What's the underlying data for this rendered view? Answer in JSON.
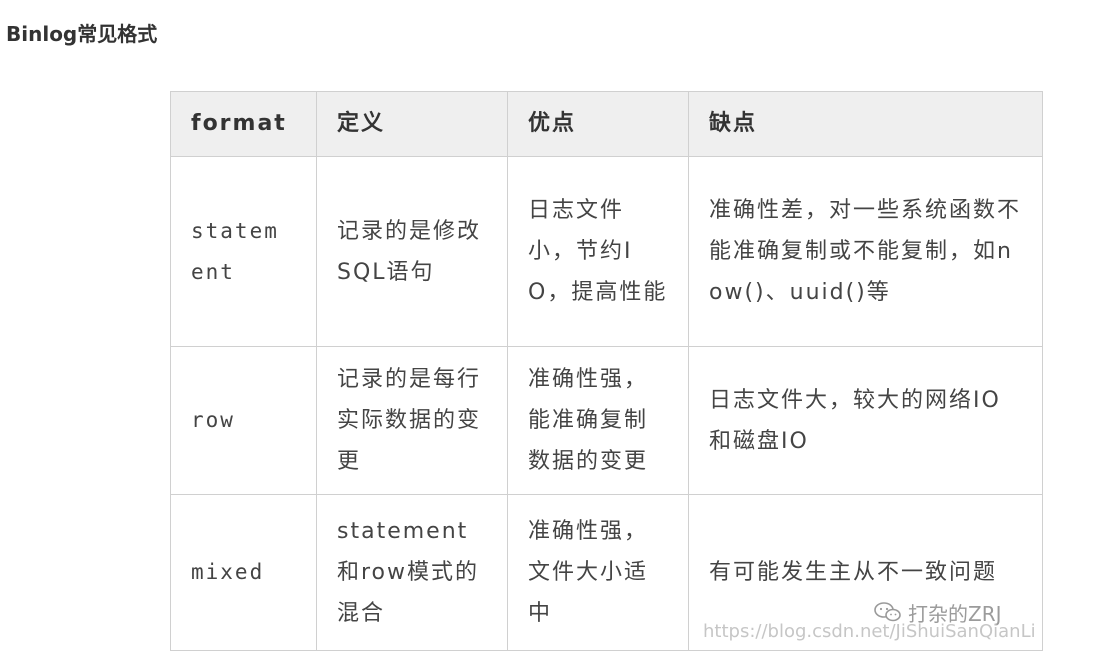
{
  "page": {
    "title": "Binlog常见格式"
  },
  "table": {
    "headers": [
      "format",
      "定义",
      "优点",
      "缺点"
    ],
    "rows": [
      {
        "format": "statem ent",
        "definition": "记录的是修改SQL语句",
        "pros": "日志文件小，节约IO，提高性能",
        "cons": "准确性差，对一些系统函数不能准确复制或不能复制，如now()、uuid()等"
      },
      {
        "format": "row",
        "definition": "记录的是每行实际数据的变更",
        "pros": "准确性强，能准确复制数据的变更",
        "cons": "日志文件大，较大的网络IO和磁盘IO"
      },
      {
        "format": "mixed",
        "definition": "statement和row模式的混合",
        "pros": "准确性强，文件大小适中",
        "cons": "有可能发生主从不一致问题"
      }
    ]
  },
  "watermark": {
    "brand": "打杂的ZRJ",
    "brand_icon": "wechat-icon",
    "url": "https://blog.csdn.net/JiShuiSanQianLi"
  }
}
